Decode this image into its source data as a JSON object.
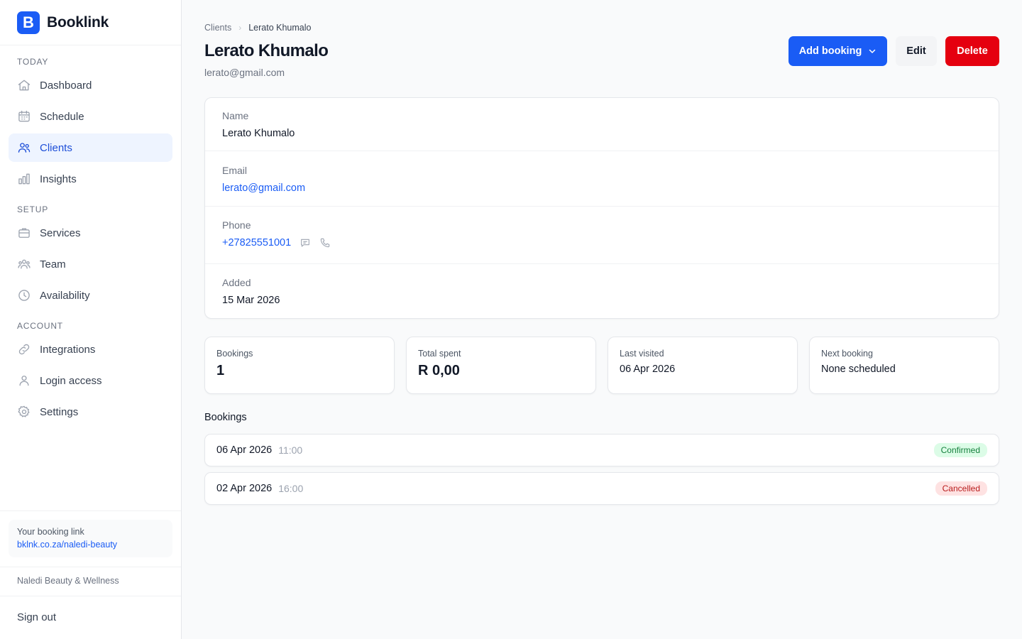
{
  "brand": {
    "logo_letter": "B",
    "name": "Booklink"
  },
  "sidebar": {
    "sections": [
      {
        "label": "TODAY"
      },
      {
        "label": "SETUP"
      },
      {
        "label": "ACCOUNT"
      }
    ],
    "items": [
      {
        "label": "Dashboard",
        "icon": "home-icon"
      },
      {
        "label": "Schedule",
        "icon": "calendar-icon"
      },
      {
        "label": "Clients",
        "icon": "users-icon",
        "active": true
      },
      {
        "label": "Insights",
        "icon": "bar-chart-icon"
      },
      {
        "label": "Services",
        "icon": "briefcase-icon"
      },
      {
        "label": "Team",
        "icon": "team-icon"
      },
      {
        "label": "Availability",
        "icon": "clock-icon"
      },
      {
        "label": "Integrations",
        "icon": "link-icon"
      },
      {
        "label": "Login access",
        "icon": "user-icon"
      },
      {
        "label": "Settings",
        "icon": "gear-icon"
      }
    ],
    "booking_link": {
      "title": "Your booking link",
      "url": "bklnk.co.za/naledi-beauty"
    },
    "business_name": "Naledi Beauty & Wellness",
    "sign_out": "Sign out"
  },
  "breadcrumb": {
    "parent": "Clients",
    "separator": "›",
    "current": "Lerato Khumalo"
  },
  "header": {
    "title": "Lerato Khumalo",
    "subtitle": "lerato@gmail.com",
    "add_booking_label": "Add booking",
    "edit_label": "Edit",
    "delete_label": "Delete"
  },
  "details": {
    "name_label": "Name",
    "name_value": "Lerato Khumalo",
    "email_label": "Email",
    "email_value": "lerato@gmail.com",
    "phone_label": "Phone",
    "phone_value": "+27825551001",
    "added_label": "Added",
    "added_value": "15 Mar 2026"
  },
  "stats": [
    {
      "label": "Bookings",
      "value": "1"
    },
    {
      "label": "Total spent",
      "value": "R 0,00"
    },
    {
      "label": "Last visited",
      "value": "06 Apr 2026"
    },
    {
      "label": "Next booking",
      "value": "None scheduled"
    }
  ],
  "bookings": {
    "title": "Bookings",
    "rows": [
      {
        "date": "06 Apr 2026",
        "time": "11:00",
        "status": "Confirmed"
      },
      {
        "date": "02 Apr 2026",
        "time": "16:00",
        "status": "Cancelled"
      }
    ]
  },
  "colors": {
    "accent": "#1a5cf5",
    "danger": "#e5000f",
    "confirmed_bg": "#dcfce7",
    "cancelled_bg": "#fee2e2"
  }
}
